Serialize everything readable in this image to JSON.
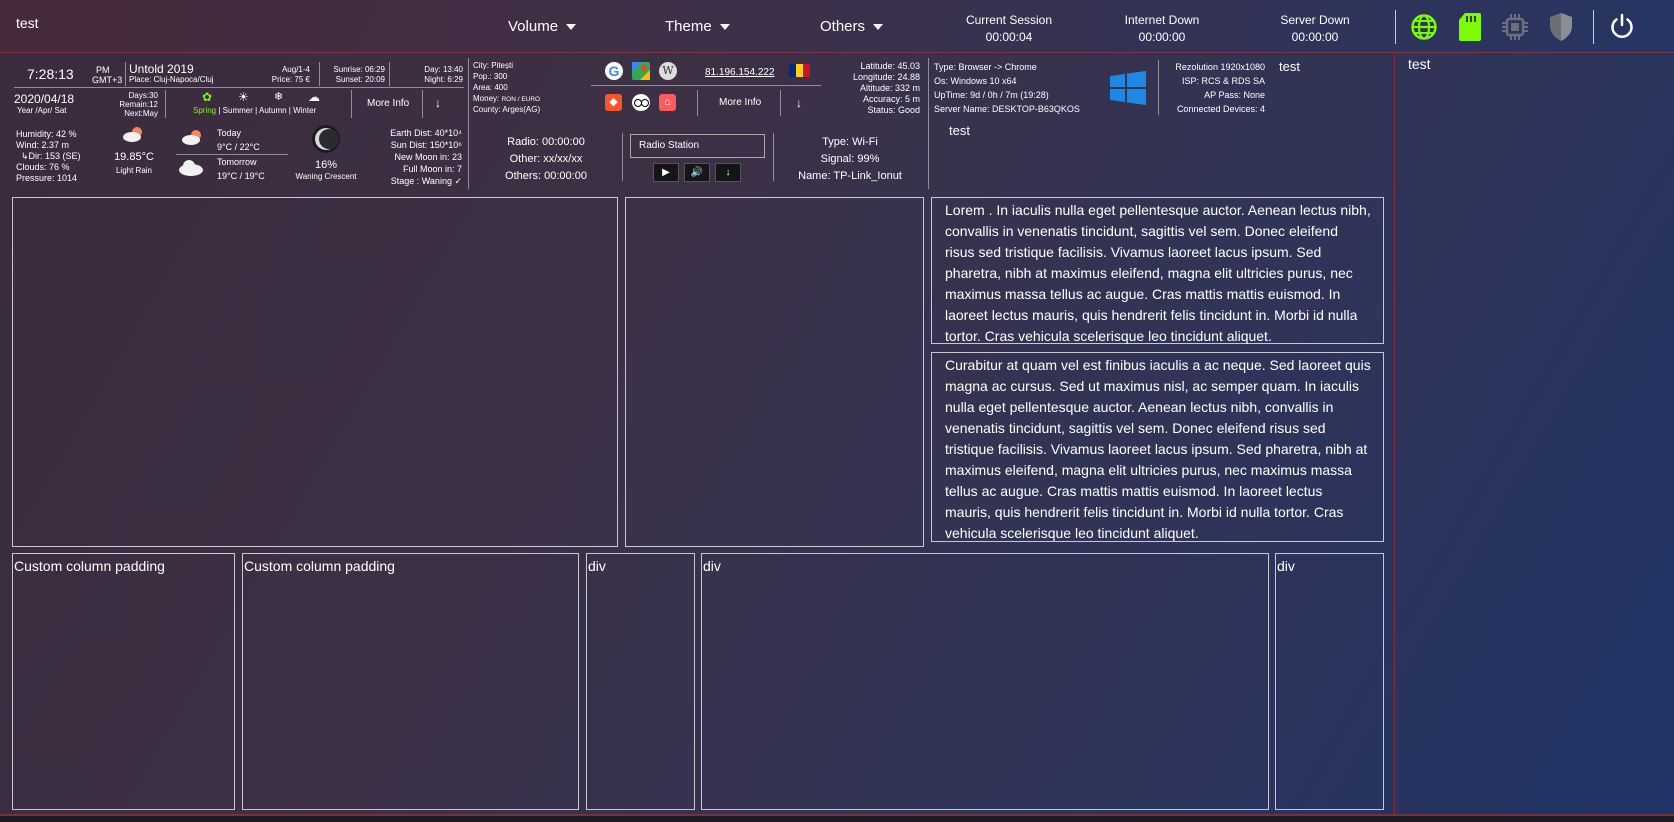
{
  "topbar": {
    "title": "test",
    "menus": [
      "Volume",
      "Theme",
      "Others"
    ],
    "session": {
      "label": "Current Session",
      "value": "00:00:04"
    },
    "internet": {
      "label": "Internet Down",
      "value": "00:00:00"
    },
    "server": {
      "label": "Server Down",
      "value": "00:00:00"
    },
    "icons": [
      "globe-icon",
      "sd-card-icon",
      "cpu-icon",
      "shield-icon",
      "power-icon"
    ],
    "colors": {
      "accent_green": "#7cfc00",
      "dim": "#6c6f78"
    }
  },
  "time": {
    "clock": "7:28:13",
    "ampm": "PM",
    "gmt": "GMT+3",
    "event": "Untold 2019",
    "place": "Place: Cluj-Napoca/Cluj",
    "event_dates": "Aug/1-4",
    "price": "Price: 75 €",
    "sunrise": "Sunrise: 06:29",
    "sunset": "Sunset:  20:09",
    "day": "Day:  13:40",
    "night": "Night: 6:29",
    "date": "2020/04/18",
    "date_format": "Year /Apr/ Sat",
    "days": "Days:30",
    "remain": "Remain:12",
    "next": "Next:May",
    "seasons": [
      "Spring",
      "Summer",
      "Autumn",
      "Winter"
    ],
    "more_info": "More Info"
  },
  "weather": {
    "humidity": "Humidity: 42 %",
    "wind": "Wind: 2.37 m",
    "dir": "↳Dir: 153 (SE)",
    "clouds": "Clouds: 76 %",
    "pressure": "Pressure: 1014",
    "temp": "19.85°C",
    "desc": "Light Rain",
    "today": "Today",
    "today_temp": "9°C / 22°C",
    "tomorrow": "Tomorrow",
    "tomorrow_temp": "19°C / 19°C",
    "moon_pct": "16%",
    "moon_phase": "Waning Crescent",
    "earth_dist": "Earth Dist: 40*10⁴",
    "sun_dist": "Sun Dist: 150*10⁶",
    "new_moon": "New Moon in: 23",
    "full_moon": "Full Moon in: 7",
    "stage": "Stage : Waning ✓"
  },
  "location": {
    "city": "City: Pitești",
    "pop": "Pop.: 300",
    "area": "Area: 400",
    "money_label": "Money: ",
    "money": "RON / EURO",
    "county": "County: Arges(AG)",
    "ip": "81.196.154.222",
    "more_info": "More Info",
    "latitude": "Latitude: 45.03",
    "longitude": "Longitude: 24.88",
    "altitude": "Altitude: 332 m",
    "accuracy": "Accuracy: 5 m",
    "status": "Status: Good"
  },
  "radio": {
    "radio": "Radio: 00:00:00",
    "other": "Other: xx/xx/xx",
    "others": "Others: 00:00:00",
    "station_placeholder": "Radio Station",
    "type": "Type: Wi-Fi",
    "signal": "Signal: 99%",
    "name": "Name: TP-Link_Ionut"
  },
  "system": {
    "type": "Type: Browser -> Chrome",
    "os": "Os: Windows 10 x64",
    "uptime": "UpTime: 9d / 0h / 7m (19:28)",
    "server_name": "Server Name: DESKTOP-B63QKOS",
    "resolution": "Rezolution 1920x1080",
    "isp": "ISP: RCS & RDS SA",
    "ap": "AP Pass: None",
    "devices": "Connected Devices: 4",
    "test_a": "test",
    "test_b": "test"
  },
  "sidebar": {
    "title": "test"
  },
  "panels": {
    "lorem1": "Lorem . In iaculis nulla eget pellentesque auctor. Aenean lectus nibh, convallis in venenatis tincidunt, sagittis vel sem. Donec eleifend risus sed tristique facilisis. Vivamus laoreet lacus ipsum. Sed pharetra, nibh at maximus eleifend, magna elit ultricies purus, nec maximus massa tellus ac augue. Cras mattis mattis euismod. In laoreet lectus mauris, quis hendrerit felis tincidunt in. Morbi id nulla tortor. Cras vehicula scelerisque leo tincidunt aliquet.",
    "lorem2": "Curabitur at quam vel est finibus iaculis a ac neque. Sed laoreet quis magna ac cursus. Sed ut maximus nisl, ac semper quam. In iaculis nulla eget pellentesque auctor. Aenean lectus nibh, convallis in venenatis tincidunt, sagittis vel sem. Donec eleifend risus sed tristique facilisis. Vivamus laoreet lacus ipsum. Sed pharetra, nibh at maximus eleifend, magna elit ultricies purus, nec maximus massa tellus ac augue. Cras mattis mattis euismod. In laoreet lectus mauris, quis hendrerit felis tincidunt in. Morbi id nulla tortor. Cras vehicula scelerisque leo tincidunt aliquet.",
    "bottom": [
      "Custom column padding",
      "Custom column padding",
      "div",
      "div",
      "div"
    ]
  }
}
